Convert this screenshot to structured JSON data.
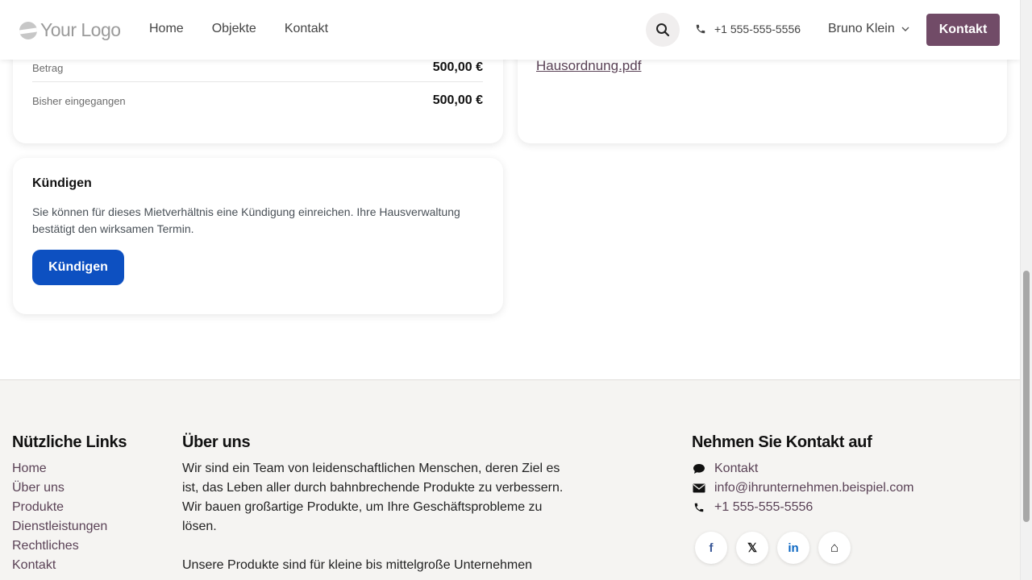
{
  "header": {
    "logo_text": "Your Logo",
    "nav": [
      {
        "label": "Home"
      },
      {
        "label": "Objekte"
      },
      {
        "label": "Kontakt"
      }
    ],
    "phone": "+1 555-555-5556",
    "user_name": "Bruno Klein",
    "cta_label": "Kontakt"
  },
  "payment": {
    "rows": [
      {
        "label": "Betrag",
        "value": "500,00 €"
      },
      {
        "label": "Bisher eingegangen",
        "value": "500,00 €"
      }
    ]
  },
  "documents": {
    "file_name": "Hausordnung.pdf"
  },
  "cancellation": {
    "title": "Kündigen",
    "text": "Sie können für dieses Mietverhältnis eine Kündigung einreichen. Ihre Hausverwaltung bestätigt den wirksamen Termin.",
    "button_label": "Kündigen"
  },
  "footer": {
    "links_heading": "Nützliche Links",
    "links": [
      {
        "label": "Home"
      },
      {
        "label": "Über uns"
      },
      {
        "label": "Produkte"
      },
      {
        "label": "Dienstleistungen"
      },
      {
        "label": "Rechtliches"
      },
      {
        "label": "Kontakt"
      }
    ],
    "about_heading": "Über uns",
    "about_p1": "Wir sind ein Team von leidenschaftlichen Menschen, deren Ziel es ist, das Leben aller durch bahnbrechende Produkte zu verbessern. Wir bauen großartige Produkte, um Ihre Geschäftsprobleme zu lösen.",
    "about_p2": "Unsere Produkte sind für kleine bis mittelgroße Unternehmen",
    "contact_heading": "Nehmen Sie Kontakt auf",
    "contact": {
      "label": "Kontakt",
      "email": "info@ihrunternehmen.beispiel.com",
      "phone": "+1 555-555-5556"
    },
    "socials": [
      {
        "icon": "facebook-icon",
        "glyph": "f",
        "color": "#3b5998"
      },
      {
        "icon": "x-icon",
        "glyph": "𝕏",
        "color": "#111111"
      },
      {
        "icon": "linkedin-icon",
        "glyph": "in",
        "color": "#0a66c2"
      },
      {
        "icon": "home-icon",
        "glyph": "⌂",
        "color": "#111111"
      }
    ]
  },
  "colors": {
    "brand": "#714b67",
    "primary_button": "#0d50c1",
    "footer_bg": "#f5f4f2"
  }
}
